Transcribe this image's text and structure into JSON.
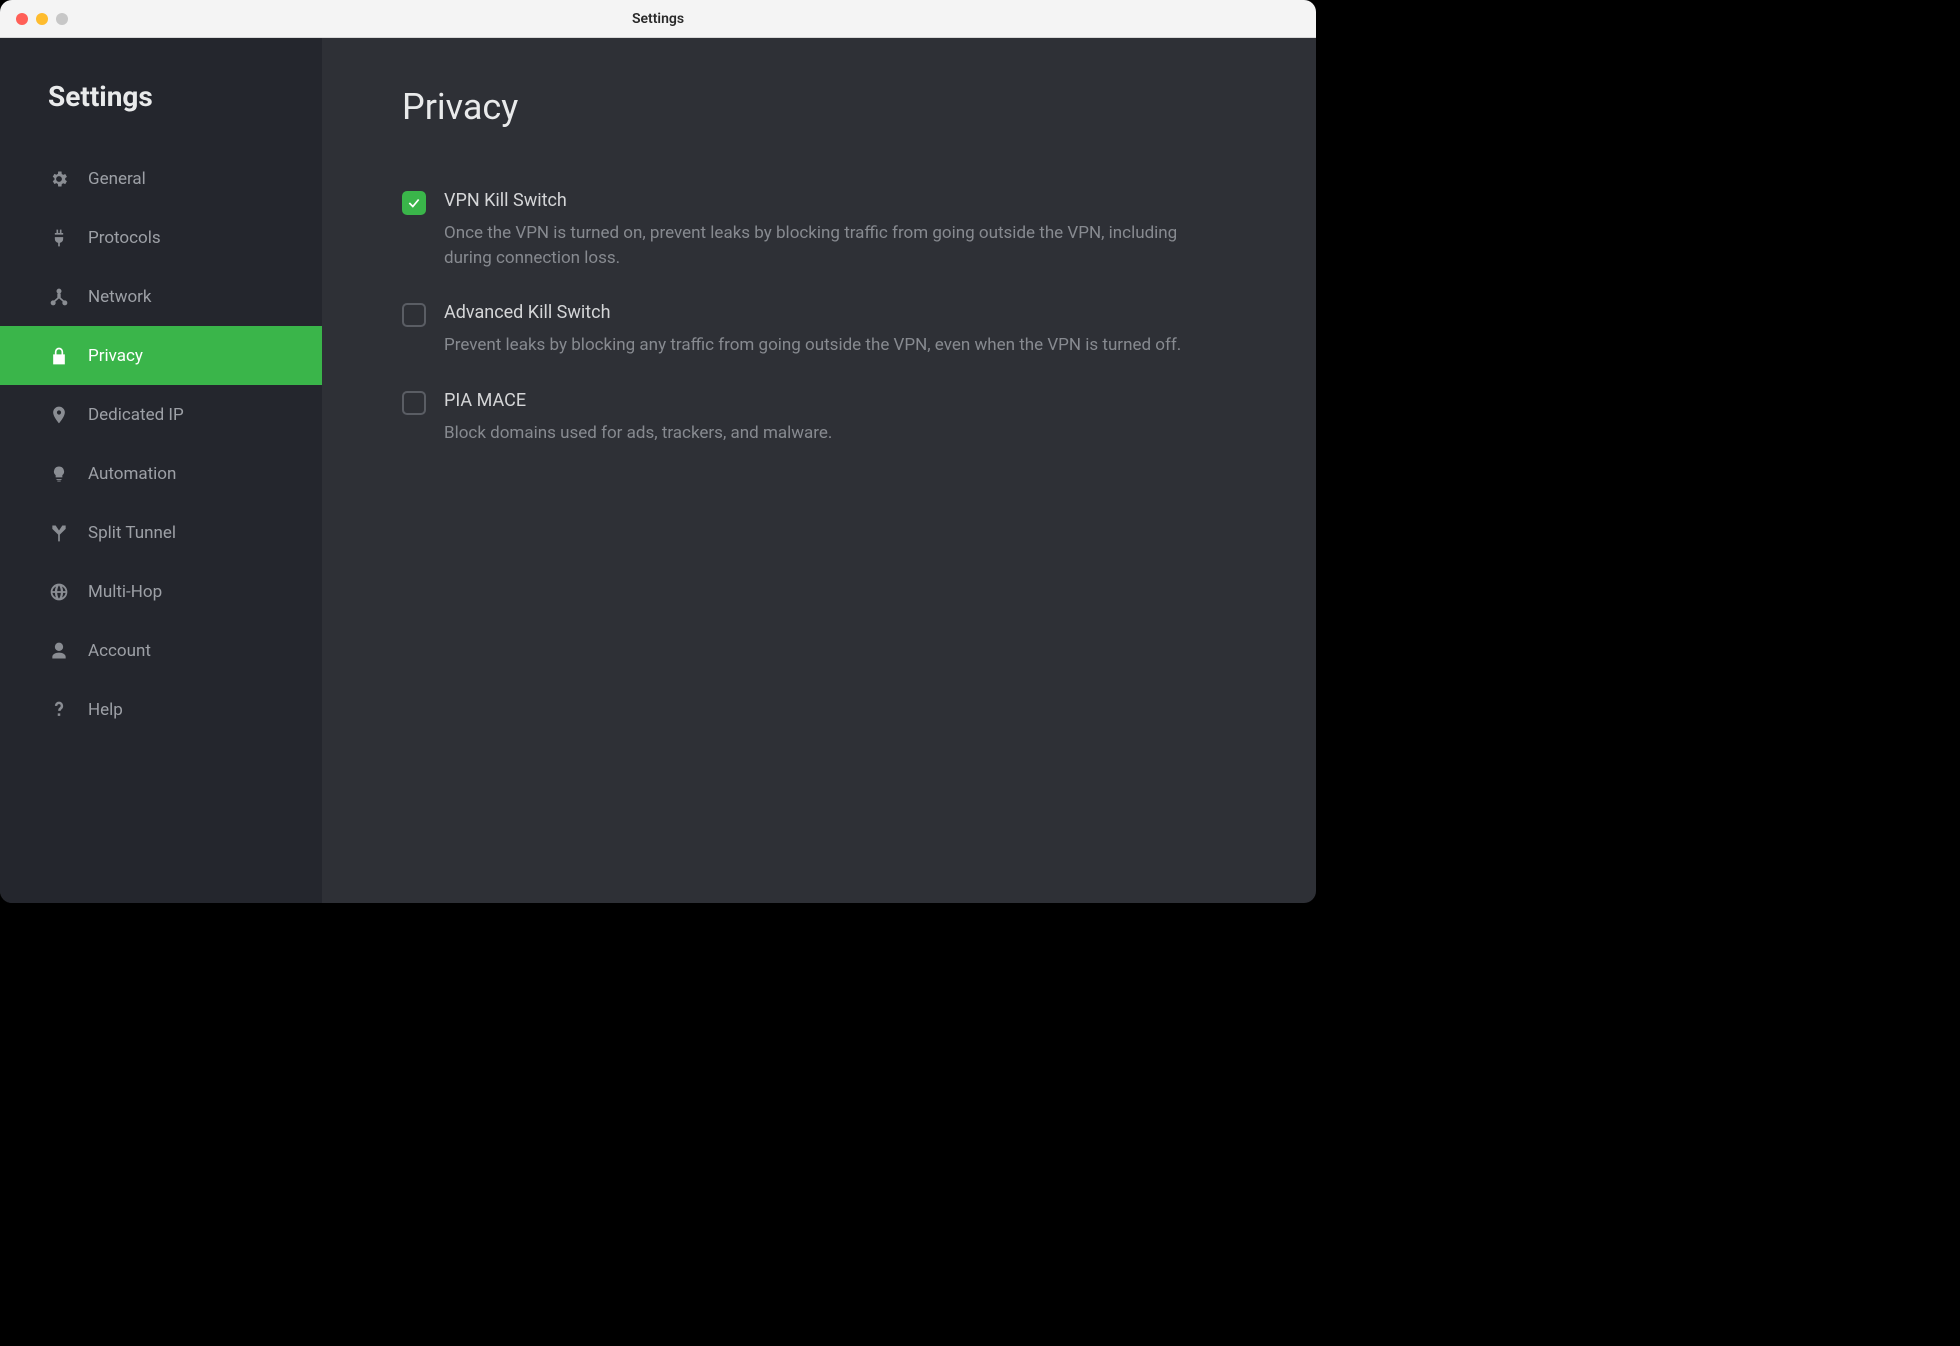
{
  "window": {
    "title": "Settings"
  },
  "sidebar": {
    "title": "Settings",
    "items": [
      {
        "label": "General",
        "icon": "gear-icon",
        "active": false
      },
      {
        "label": "Protocols",
        "icon": "plug-icon",
        "active": false
      },
      {
        "label": "Network",
        "icon": "network-icon",
        "active": false
      },
      {
        "label": "Privacy",
        "icon": "lock-icon",
        "active": true
      },
      {
        "label": "Dedicated IP",
        "icon": "pin-icon",
        "active": false
      },
      {
        "label": "Automation",
        "icon": "bulb-icon",
        "active": false
      },
      {
        "label": "Split Tunnel",
        "icon": "split-icon",
        "active": false
      },
      {
        "label": "Multi-Hop",
        "icon": "globe-icon",
        "active": false
      },
      {
        "label": "Account",
        "icon": "user-icon",
        "active": false
      },
      {
        "label": "Help",
        "icon": "question-icon",
        "active": false
      }
    ]
  },
  "main": {
    "title": "Privacy",
    "settings": [
      {
        "label": "VPN Kill Switch",
        "desc": "Once the VPN is turned on, prevent leaks by blocking traffic from going outside the VPN, including during connection loss.",
        "checked": true
      },
      {
        "label": "Advanced Kill Switch",
        "desc": "Prevent leaks by blocking any traffic from going outside the VPN, even when the VPN is turned off.",
        "checked": false
      },
      {
        "label": "PIA MACE",
        "desc": "Block domains used for ads, trackers, and malware.",
        "checked": false
      }
    ]
  },
  "colors": {
    "accent": "#3ab54a",
    "sidebar": "#24262d",
    "main": "#2e3036"
  }
}
